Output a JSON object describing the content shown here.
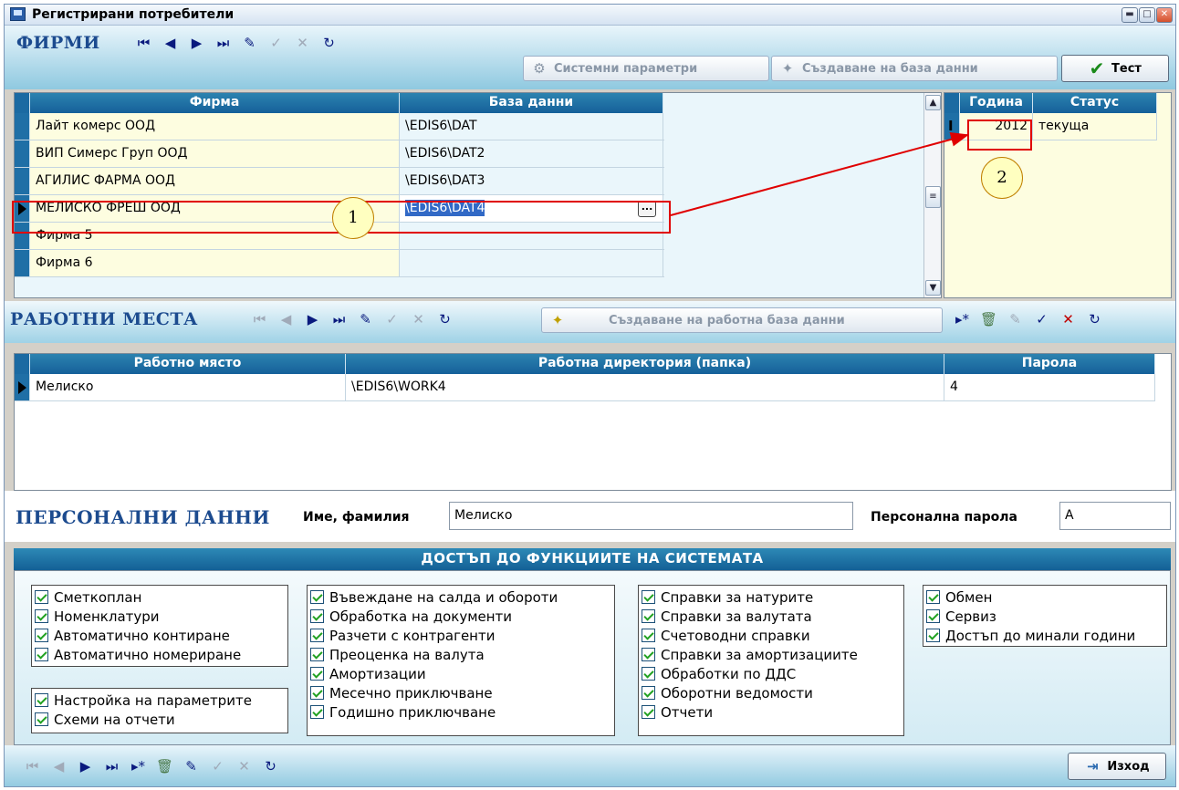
{
  "window": {
    "title": "Регистрирани потребители"
  },
  "firms_section": {
    "title": "ФИРМИ",
    "system_params_label": "Системни параметри",
    "create_db_label": "Създаване на база данни",
    "test_label": "Тест",
    "columns": [
      "Фирма",
      "База данни"
    ],
    "rows": [
      {
        "firm": "Лайт комерс ООД",
        "db": "\\EDIS6\\DAT"
      },
      {
        "firm": "ВИП Симерс Груп ООД",
        "db": "\\EDIS6\\DAT2"
      },
      {
        "firm": "АГИЛИС ФАРМА ООД",
        "db": "\\EDIS6\\DAT3"
      },
      {
        "firm": "МЕЛИСКО ФРЕШ ООД",
        "db": "\\EDIS6\\DAT4"
      },
      {
        "firm": "Фирма 5",
        "db": ""
      },
      {
        "firm": "Фирма 6",
        "db": ""
      }
    ],
    "selected_row": 3,
    "ellipsis_label": "...",
    "years_columns": [
      "Година",
      "Статус"
    ],
    "years_rows": [
      {
        "year": "2012",
        "status": "текуща"
      }
    ]
  },
  "workplaces_section": {
    "title": "РАБОТНИ МЕСТА",
    "create_work_db_label": "Създаване на работна база данни",
    "columns": [
      "Работно място",
      "Работна директория (папка)",
      "Парола"
    ],
    "rows": [
      {
        "place": "Мелиско",
        "dir": "\\EDIS6\\WORK4",
        "password": "4"
      }
    ]
  },
  "personal_section": {
    "title": "ПЕРСОНАЛНИ ДАННИ",
    "name_label": "Име, фамилия",
    "name_value": "Мелиско",
    "password_label": "Персонална парола",
    "password_value": "A"
  },
  "access_section": {
    "title": "ДОСТЪП ДО ФУНКЦИИТЕ НА СИСТЕМАТА",
    "group1": [
      "Сметкоплан",
      "Номенклатури",
      "Автоматично контиране",
      "Автоматично номериране"
    ],
    "group2": [
      "Настройка на параметрите",
      "Схеми на отчети"
    ],
    "group3": [
      "Въвеждане на салда и обороти",
      "Обработка на документи",
      "Разчети с контрагенти",
      "Преоценка на валута",
      "Амортизации",
      "Месечно приключване",
      "Годишно приключване"
    ],
    "group4": [
      "Справки за натурите",
      "Справки за валутата",
      "Счетоводни справки",
      "Справки за амортизациите",
      "Обработки по ДДС",
      "Оборотни ведомости",
      "Отчети"
    ],
    "group5": [
      "Обмен",
      "Сервиз",
      "Достъп до минали години"
    ]
  },
  "footer": {
    "exit_label": "Изход"
  },
  "annotations": {
    "callout1": "1",
    "callout2": "2"
  },
  "colors": {
    "header_blue": "#1b6aa2",
    "title_blue": "#1c4b8f",
    "highlight_red": "#e00000",
    "callout_fill": "#ffffc0"
  }
}
